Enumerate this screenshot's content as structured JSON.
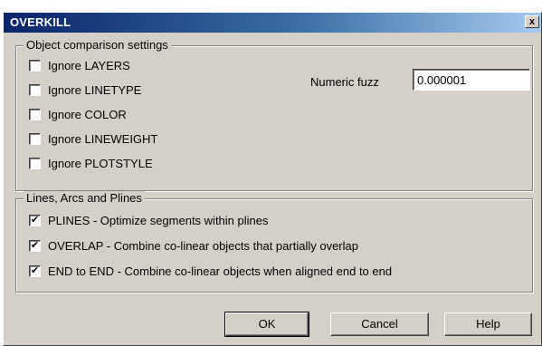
{
  "window": {
    "title": "OVERKILL",
    "close_label": "x"
  },
  "object_group": {
    "title": "Object comparison settings",
    "options": [
      {
        "label": "Ignore LAYERS",
        "checked": false
      },
      {
        "label": "Ignore LINETYPE",
        "checked": false
      },
      {
        "label": "Ignore COLOR",
        "checked": false
      },
      {
        "label": "Ignore LINEWEIGHT",
        "checked": false
      },
      {
        "label": "Ignore PLOTSTYLE",
        "checked": false
      }
    ],
    "fuzz_label": "Numeric fuzz",
    "fuzz_value": "0.000001"
  },
  "lines_group": {
    "title": "Lines, Arcs and Plines",
    "options": [
      {
        "label": "PLINES - Optimize segments within plines",
        "checked": true
      },
      {
        "label": "OVERLAP - Combine co-linear objects that partially overlap",
        "checked": true
      },
      {
        "label": "END to END - Combine co-linear objects when aligned end to end",
        "checked": true
      }
    ]
  },
  "buttons": {
    "ok": "OK",
    "cancel": "Cancel",
    "help": "Help"
  },
  "check_mark": "✔"
}
